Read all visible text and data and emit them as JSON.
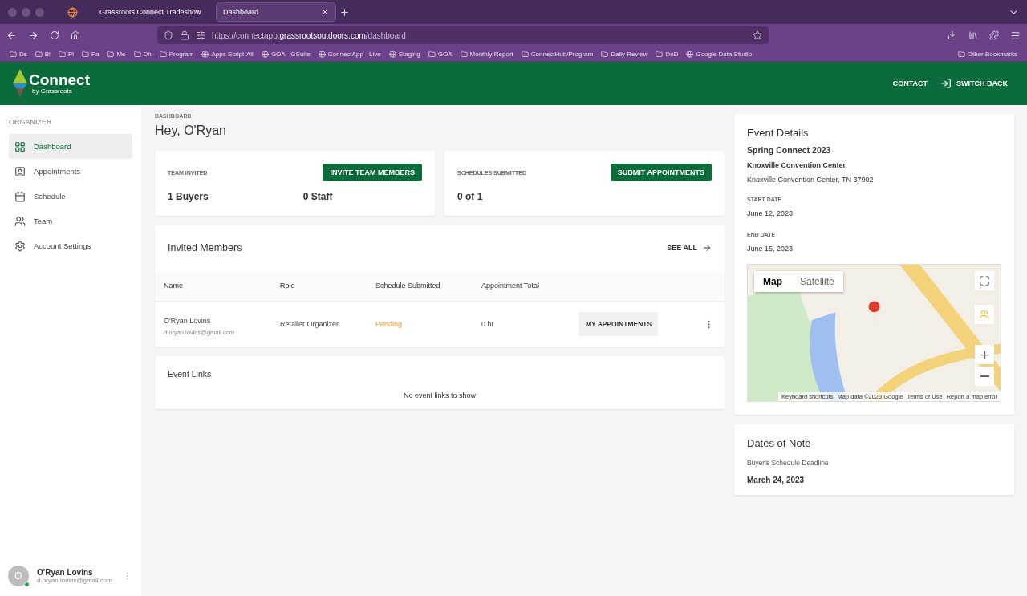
{
  "browser": {
    "tabs": [
      {
        "title": "Grassroots Connect Tradeshow",
        "selected": false
      },
      {
        "title": "Dashboard",
        "selected": true
      }
    ],
    "url": "https://connectapp.**grassrootsoutdoors.com**/dashboard",
    "bookmarks": [
      {
        "label": "Ds",
        "kind": "folder"
      },
      {
        "label": "Bl",
        "kind": "folder"
      },
      {
        "label": "Pi",
        "kind": "folder"
      },
      {
        "label": "Fa",
        "kind": "folder"
      },
      {
        "label": "Me",
        "kind": "folder"
      },
      {
        "label": "Dh",
        "kind": "folder"
      },
      {
        "label": "Program",
        "kind": "folder"
      },
      {
        "label": "Apps Script-All",
        "kind": "site"
      },
      {
        "label": "GOA - GSuite",
        "kind": "site"
      },
      {
        "label": "ConnectApp - Live",
        "kind": "site"
      },
      {
        "label": "Staging",
        "kind": "site"
      },
      {
        "label": "GOA",
        "kind": "folder"
      },
      {
        "label": "Monthly Report",
        "kind": "folder"
      },
      {
        "label": "ConnectHub/Program",
        "kind": "folder"
      },
      {
        "label": "Daily Review",
        "kind": "folder"
      },
      {
        "label": "DnD",
        "kind": "folder"
      },
      {
        "label": "Google Data Studio",
        "kind": "site"
      }
    ],
    "other_bookmarks": "Other Bookmarks"
  },
  "header": {
    "logo": {
      "name": "Connect",
      "tagline": "by Grassroots"
    },
    "contact": "CONTACT",
    "switch_back": "SWITCH BACK"
  },
  "sidebar": {
    "section": "ORGANIZER",
    "items": [
      {
        "label": "Dashboard",
        "selected": true
      },
      {
        "label": "Appointments",
        "selected": false
      },
      {
        "label": "Schedule",
        "selected": false
      },
      {
        "label": "Team",
        "selected": false
      },
      {
        "label": "Account Settings",
        "selected": false
      }
    ],
    "user": {
      "initial": "O",
      "name": "O'Ryan Lovins",
      "email": "d.oryan.lovins@gmail.com",
      "online": true
    }
  },
  "main": {
    "breadcrumb": "DASHBOARD",
    "greeting": "Hey, O'Ryan",
    "team_card": {
      "label": "TEAM INVITED",
      "button": "INVITE TEAM MEMBERS",
      "buyers": "1 Buyers",
      "staff": "0 Staff"
    },
    "schedules_card": {
      "label": "SCHEDULES SUBMITTED",
      "button": "SUBMIT APPOINTMENTS",
      "value": "0 of 1"
    },
    "invited_members": {
      "title": "Invited Members",
      "see_all": "SEE ALL",
      "columns": [
        "Name",
        "Role",
        "Schedule Submitted",
        "Appointment Total"
      ],
      "rows": [
        {
          "name": "O'Ryan Lovins",
          "email": "d.oryan.lovins@gmail.com",
          "role": "Retailer Organizer",
          "status": "Pending",
          "total": "0 hr",
          "button": "MY APPOINTMENTS"
        }
      ]
    },
    "event_links": {
      "title": "Event Links",
      "empty": "No event links to show"
    }
  },
  "event_details": {
    "title": "Event Details",
    "event": "Spring Connect 2023",
    "venue": "Knoxville Convention Center",
    "address": "Knoxville Convention Center, TN 37902",
    "start_label": "START DATE",
    "start": "June 12, 2023",
    "end_label": "END DATE",
    "end": "June 15, 2023",
    "map": {
      "types": [
        {
          "label": "Map",
          "selected": true
        },
        {
          "label": "Satellite",
          "selected": false
        }
      ],
      "attribution": [
        "Keyboard shortcuts",
        "Map data ©2023 Google",
        "Terms of Use",
        "Report a map error"
      ]
    }
  },
  "dates_of_note": {
    "title": "Dates of Note",
    "items": [
      {
        "label": "Buyer's Schedule Deadline",
        "date": "March 24, 2023"
      }
    ]
  }
}
